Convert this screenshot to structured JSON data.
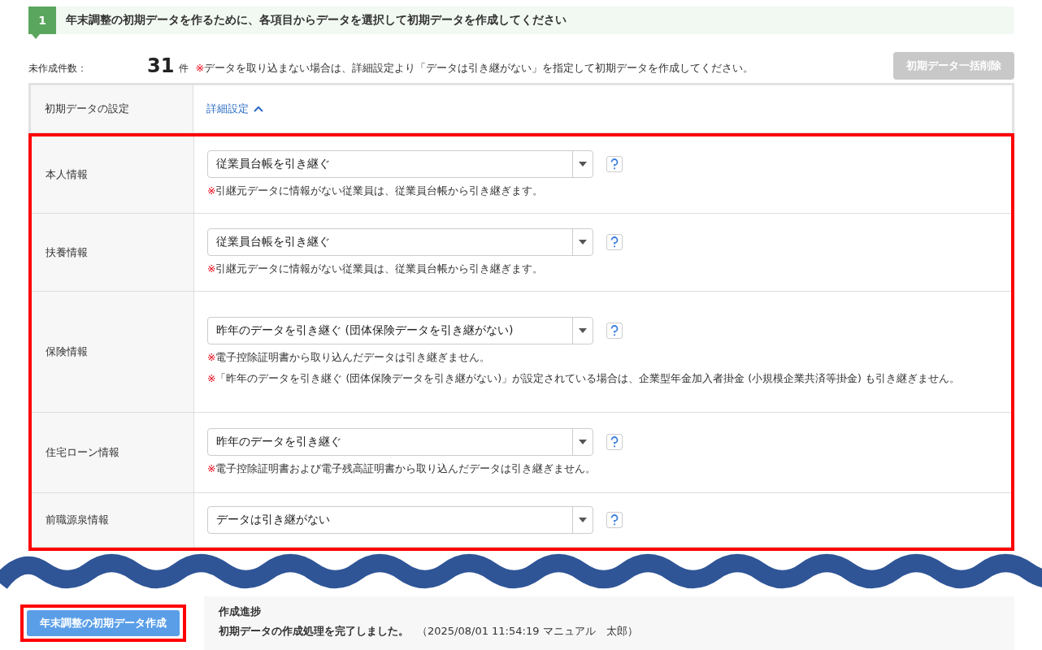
{
  "step": {
    "number": "1",
    "title": "年末調整の初期データを作るために、各項目からデータを選択して初期データを作成してください"
  },
  "summary": {
    "label": "未作成件数：",
    "count": "31",
    "unit": "件",
    "note_mark": "※",
    "note": "データを取り込まない場合は、詳細設定より「データは引き継がない」を指定して初期データを作成してください。",
    "delete_button": {
      "label": "初期データ一括削除",
      "disabled": true
    }
  },
  "settings_header": {
    "label": "初期データの設定",
    "link": "詳細設定",
    "expanded": true
  },
  "settings_highlighted": true,
  "rows": [
    {
      "label": "本人情報",
      "value": "従業員台帳を引き継ぐ",
      "notes": [
        {
          "mark": "※",
          "text": "引継元データに情報がない従業員は、従業員台帳から引き継ぎます。"
        }
      ]
    },
    {
      "label": "扶養情報",
      "value": "従業員台帳を引き継ぐ",
      "notes": [
        {
          "mark": "※",
          "text": "引継元データに情報がない従業員は、従業員台帳から引き継ぎます。"
        }
      ]
    },
    {
      "label": "保険情報",
      "value": "昨年のデータを引き継ぐ (団体保険データを引き継がない)",
      "notes": [
        {
          "mark": "※",
          "text": "電子控除証明書から取り込んだデータは引き継ぎません。"
        },
        {
          "mark": "※",
          "text": "「昨年のデータを引き継ぐ (団体保険データを引き継がない)」が設定されている場合は、企業型年金加入者掛金 (小規模企業共済等掛金) も引き継ぎません。"
        }
      ]
    },
    {
      "label": "住宅ローン情報",
      "value": "昨年のデータを引き継ぐ",
      "notes": [
        {
          "mark": "※",
          "text": "電子控除証明書および電子残高証明書から取り込んだデータは引き継ぎません。"
        }
      ]
    },
    {
      "label": "前職源泉情報",
      "value": "データは引き継がない",
      "notes": []
    }
  ],
  "create_button": {
    "label": "年末調整の初期データ作成",
    "highlighted": true
  },
  "progress": {
    "title": "作成進捗",
    "message": "初期データの作成処理を完了しました。",
    "detail": "（2025/08/01 11:54:19 マニュアル　太郎）"
  }
}
